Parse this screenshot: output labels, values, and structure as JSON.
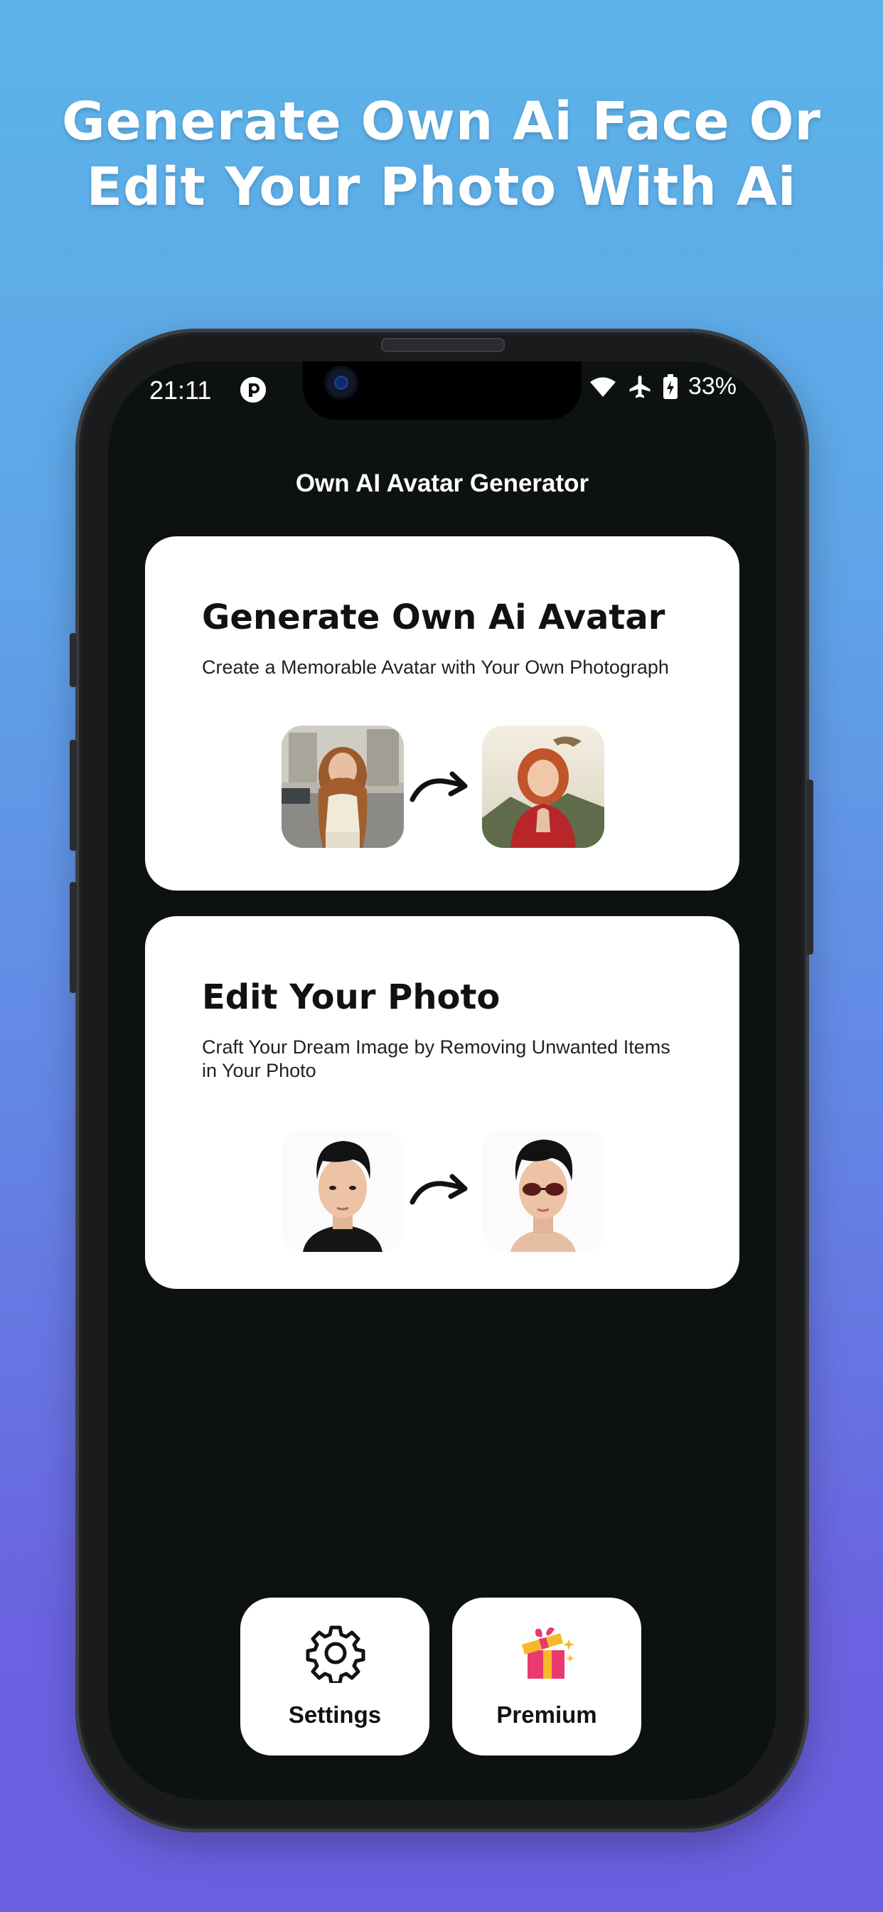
{
  "headline": {
    "line1": "Generate Own Ai Face Or",
    "line2": "Edit Your Photo With Ai"
  },
  "status_bar": {
    "time": "21:11",
    "battery": "33%"
  },
  "app": {
    "title": "Own AI Avatar Generator"
  },
  "cards": [
    {
      "title": "Generate Own Ai Avatar",
      "description": "Create a Memorable Avatar with Your Own Photograph"
    },
    {
      "title": "Edit Your Photo",
      "description": "Craft Your Dream Image by Removing Unwanted Items in Your Photo"
    }
  ],
  "bottom_buttons": {
    "settings_label": "Settings",
    "premium_label": "Premium"
  },
  "icons": {
    "settings": "gear-icon",
    "premium": "gift-icon",
    "wifi": "wifi-icon",
    "airplane": "airplane-icon",
    "battery": "battery-icon",
    "arrow": "curved-arrow-icon"
  },
  "colors": {
    "screen_bg": "#0e1112",
    "card_bg": "#ffffff",
    "gift_pink": "#e83a6e",
    "gift_yellow": "#f6b92b"
  }
}
